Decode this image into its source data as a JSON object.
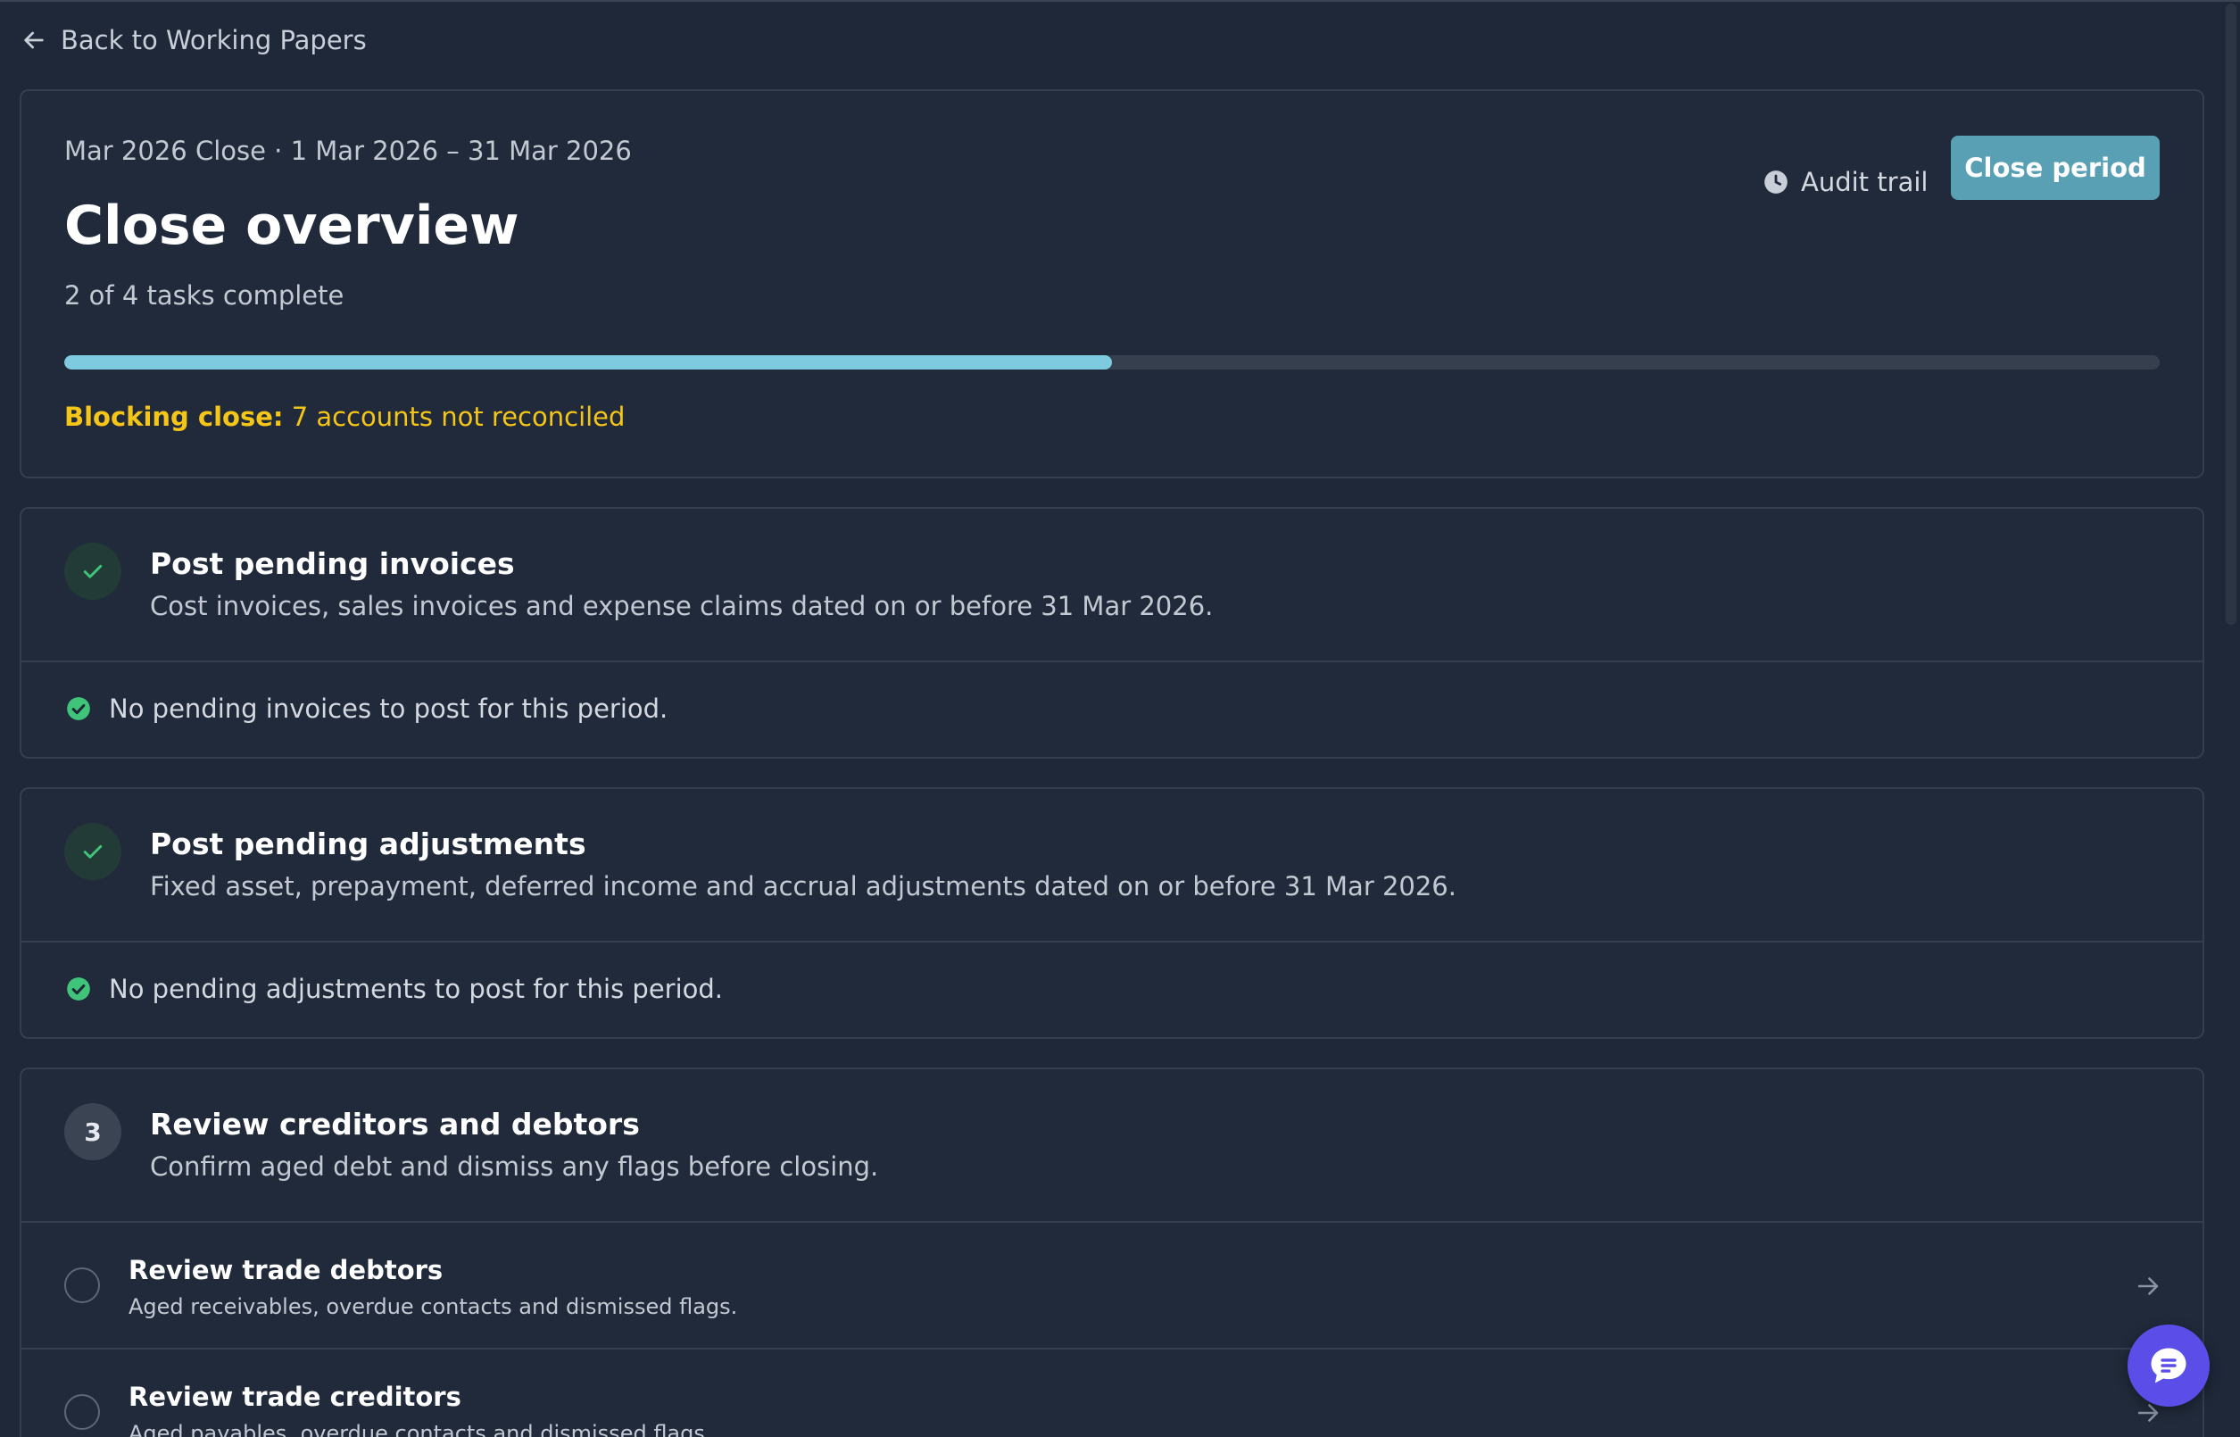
{
  "nav": {
    "back_label": "Back to Working Papers"
  },
  "header": {
    "subtitle": "Mar 2026 Close · 1 Mar 2026 – 31 Mar 2026",
    "title": "Close overview",
    "tasks_complete": "2 of 4 tasks complete",
    "progress_fraction": 0.5,
    "blocking_prefix": "Blocking close:",
    "blocking_text": "7 accounts not reconciled",
    "audit_trail_label": "Audit trail",
    "close_period_label": "Close period"
  },
  "tasks": [
    {
      "status": "done",
      "title": "Post pending invoices",
      "description": "Cost invoices, sales invoices and expense claims dated on or before 31 Mar 2026.",
      "status_message": "No pending invoices to post for this period."
    },
    {
      "status": "done",
      "title": "Post pending adjustments",
      "description": "Fixed asset, prepayment, deferred income and accrual adjustments dated on or before 31 Mar 2026.",
      "status_message": "No pending adjustments to post for this period."
    },
    {
      "status": "pending",
      "number": "3",
      "title": "Review creditors and debtors",
      "description": "Confirm aged debt and dismiss any flags before closing.",
      "subtasks": [
        {
          "title": "Review trade debtors",
          "description": "Aged receivables, overdue contacts and dismissed flags."
        },
        {
          "title": "Review trade creditors",
          "description": "Aged payables, overdue contacts and dismissed flags."
        }
      ]
    }
  ],
  "colors": {
    "background": "#1f2838",
    "accent": "#5aa0b4",
    "progress": "#7ecbe0",
    "warning": "#f5c518",
    "success": "#3fc47a",
    "chat": "#5b4de8"
  },
  "icons": {
    "back": "arrow-left-icon",
    "audit": "clock-icon",
    "done": "check-icon",
    "status_ok": "check-circle-icon",
    "row_arrow": "arrow-right-icon",
    "chat": "chat-icon"
  }
}
